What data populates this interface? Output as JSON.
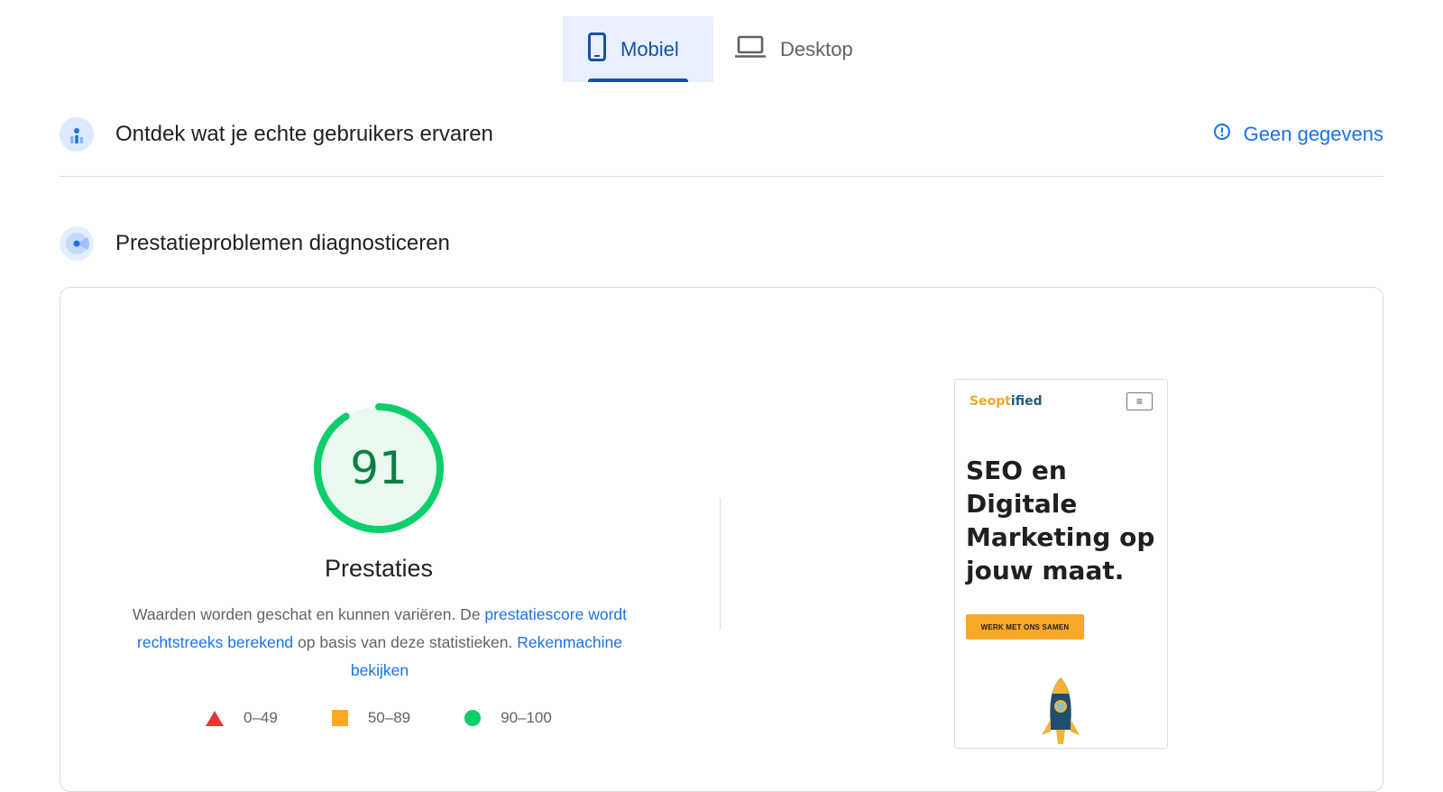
{
  "tabs": [
    {
      "label": "Mobiel",
      "icon": "smartphone-icon",
      "active": true
    },
    {
      "label": "Desktop",
      "icon": "laptop-icon",
      "active": false
    }
  ],
  "field_data": {
    "title": "Ontdek wat je echte gebruikers ervaren",
    "status": "Geen gegevens",
    "status_icon": "info-icon"
  },
  "diagnostics": {
    "title": "Prestatieproblemen diagnosticeren"
  },
  "performance": {
    "score": "91",
    "score_value": 91,
    "label": "Prestaties",
    "desc_part1": "Waarden worden geschat en kunnen variëren. De ",
    "desc_link1": "prestatiescore wordt rechtstreeks berekend",
    "desc_part2": " op basis van deze statistieken. ",
    "desc_link2": "Rekenmachine bekijken",
    "color_good": "#0cce6b"
  },
  "legend": [
    {
      "range": "0–49",
      "shape": "triangle",
      "color": "#e53935"
    },
    {
      "range": "50–89",
      "shape": "square",
      "color": "#ffa726"
    },
    {
      "range": "90–100",
      "shape": "circle",
      "color": "#0cce6b"
    }
  ],
  "screenshot": {
    "logo_main": "Seopt",
    "logo_tail": "ified",
    "menu_icon": "≡",
    "headline": "SEO en Digitale Marketing op jouw maat.",
    "cta": "WERK MET ONS SAMEN"
  }
}
